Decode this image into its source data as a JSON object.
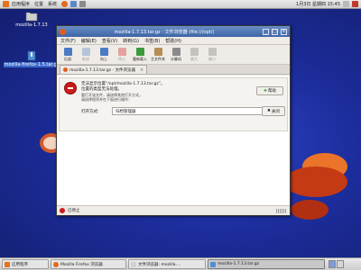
{
  "top_panel": {
    "menus": [
      "应用程序",
      "位置",
      "系统"
    ],
    "clock": "1月3日 星期四 15:45"
  },
  "desktop": {
    "icons": [
      {
        "label": "mozilla-1.7.13",
        "icon": "folder-icon"
      },
      {
        "label": "mozilla-firefox-1.5.tar.gz",
        "icon": "archive-icon"
      }
    ]
  },
  "window": {
    "title": "mozilla-1.7.13.tar.gz - 文件浏览器 (file:///opt/)",
    "menubar": [
      "文件(F)",
      "编辑(E)",
      "查看(V)",
      "转到(G)",
      "书签(B)",
      "帮助(H)"
    ],
    "toolbar": [
      {
        "label": "后退",
        "icon": "back-icon"
      },
      {
        "label": "前进",
        "icon": "forward-icon"
      },
      {
        "label": "向上",
        "icon": "up-icon"
      },
      {
        "label": "停止",
        "icon": "stop-icon"
      },
      {
        "label": "重新载入",
        "icon": "reload-icon"
      },
      {
        "label": "主文件夹",
        "icon": "home-icon"
      },
      {
        "label": "计算机",
        "icon": "computer-icon"
      },
      {
        "label": "放大",
        "icon": "zoom-in-icon"
      },
      {
        "label": "缩小",
        "icon": "zoom-out-icon"
      }
    ],
    "tab": {
      "label": "mozilla-1.7.13.tar.gz - 文件浏览器"
    },
    "message": {
      "line1": "无法显示位置“/opt/mozilla-1.7.13.tar.gz”。",
      "line2": "位置的类型无法处理。",
      "line3": "要打开该文件，请选择其他打开方式。",
      "line4": "请选择程序并在下面进行操作："
    },
    "help_button": "帮助",
    "open_label": "打开方式:",
    "open_select": "归档管理器",
    "finish_button": "关闭",
    "status": "已停止"
  },
  "bottom_panel": {
    "tasks": [
      {
        "label": "应用程序",
        "icon": "app-icon"
      },
      {
        "label": "Mozilla Firefox 浏览器",
        "icon": "firefox-icon"
      },
      {
        "label": "文件浏览器: mozilla-...",
        "icon": "folder-icon"
      },
      {
        "label": "mozilla-1.7.13.tar.gz",
        "icon": "archive-icon"
      }
    ]
  },
  "colors": {
    "desktop": "#1c2d9c",
    "titlebar": "#3d64a6",
    "stop_red": "#cc1a1a",
    "ubuntu_orange": "#e9742a"
  }
}
